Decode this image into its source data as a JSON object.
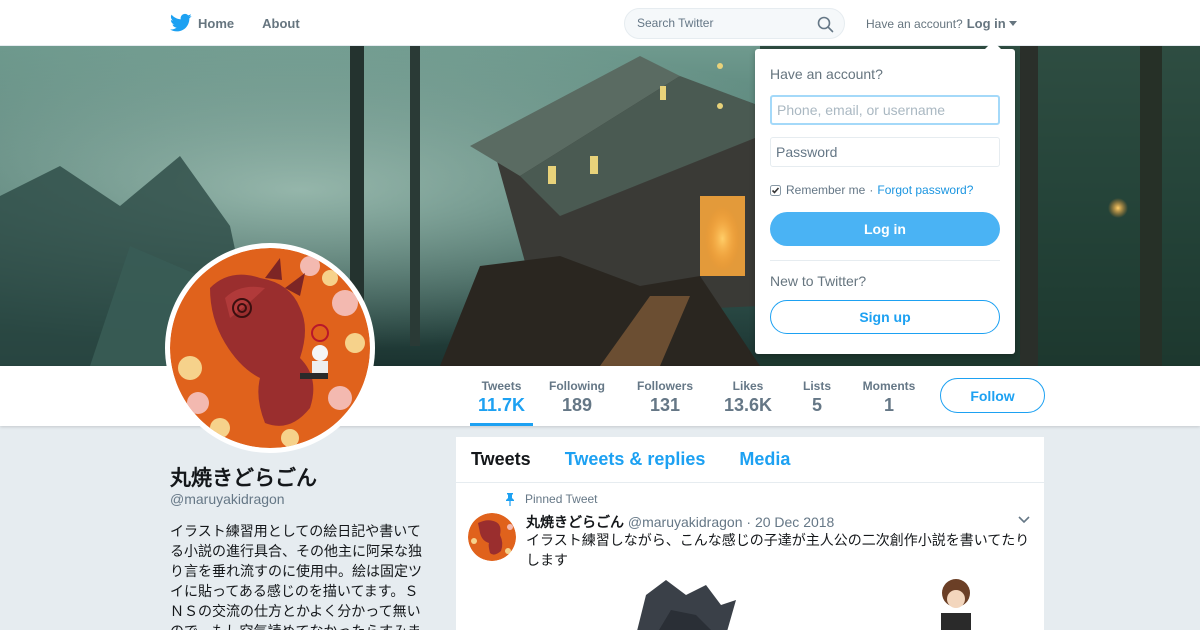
{
  "topnav": {
    "home_label": "Home",
    "about_label": "About",
    "search_placeholder": "Search Twitter",
    "account_prompt": "Have an account?",
    "login_label": "Log in"
  },
  "profile_stats": [
    {
      "label": "Tweets",
      "value": "11.7K"
    },
    {
      "label": "Following",
      "value": "189"
    },
    {
      "label": "Followers",
      "value": "131"
    },
    {
      "label": "Likes",
      "value": "13.6K"
    },
    {
      "label": "Lists",
      "value": "5"
    },
    {
      "label": "Moments",
      "value": "1"
    }
  ],
  "follow_label": "Follow",
  "profile": {
    "name": "丸焼きどらごん",
    "handle": "@maruyakidragon",
    "bio": "イラスト練習用としての絵日記や書いてる小説の進行具合、その他主に阿呆な独り言を垂れ流すのに使用中。絵は固定ツイに貼ってある感じのを描いてます。ＳＮＳの交流の仕方とかよく分かって無いので、もし空気読めてなかったらすみま"
  },
  "timeline": {
    "tabs": [
      "Tweets",
      "Tweets & replies",
      "Media"
    ],
    "pinned_label": "Pinned Tweet",
    "tweet": {
      "name": "丸焼きどらごん",
      "handle": "@maruyakidragon",
      "date": "· 20 Dec 2018",
      "text": "イラスト練習しながら、こんな感じの子達が主人公の二次創作小説を書いてたりします"
    }
  },
  "login_dropdown": {
    "title": "Have an account?",
    "username_placeholder": "Phone, email, or username",
    "password_placeholder": "Password",
    "remember_label": "Remember me",
    "separator": "·",
    "forgot_label": "Forgot password?",
    "login_button": "Log in",
    "new_prompt": "New to Twitter?",
    "signup_button": "Sign up"
  },
  "colors": {
    "accent": "#1da1f2",
    "login_button": "#4ab3f4",
    "background": "#e6ecf0"
  }
}
